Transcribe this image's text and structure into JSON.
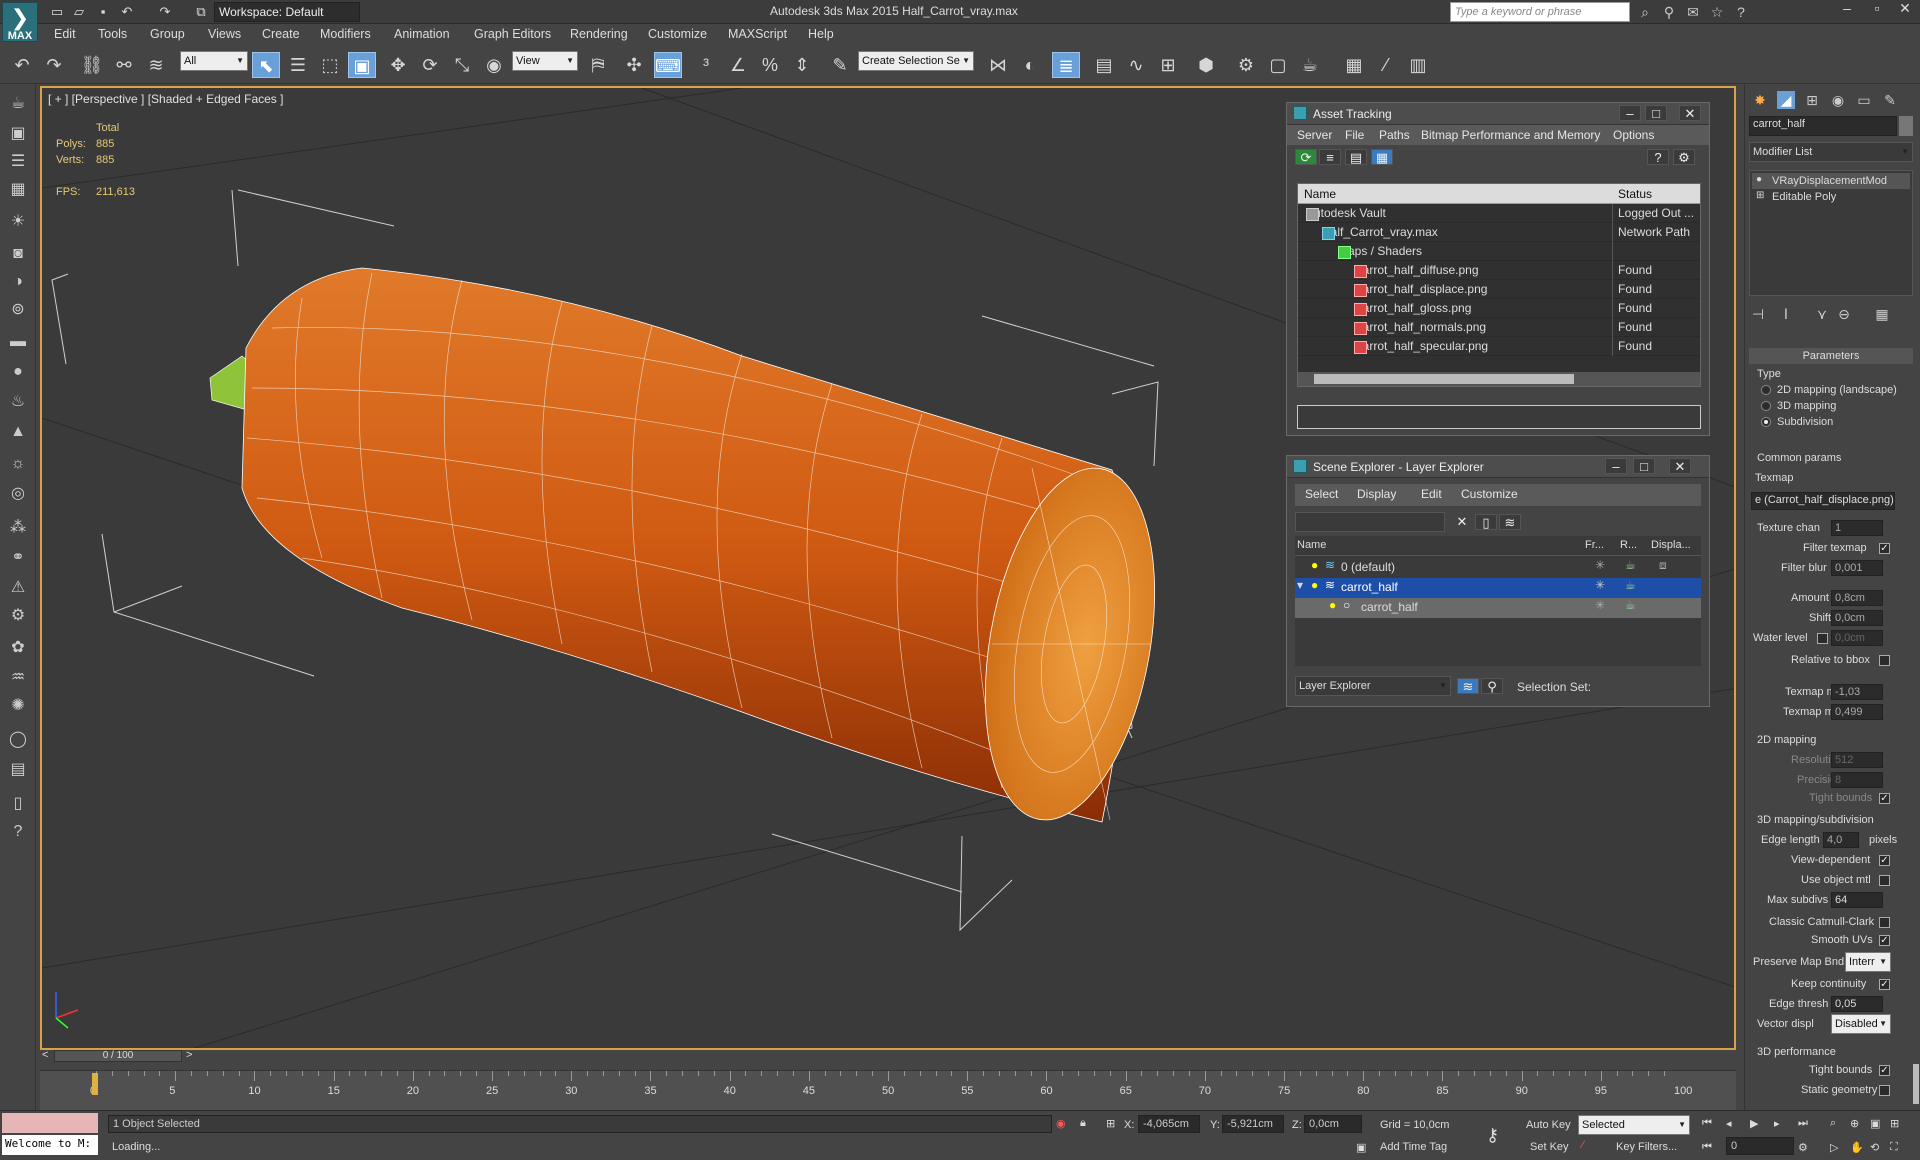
{
  "app": {
    "title": "Autodesk 3ds Max  2015    Half_Carrot_vray.max",
    "logo": "MAX",
    "workspace": "Workspace: Default",
    "search_placeholder": "Type a keyword or phrase"
  },
  "menus": [
    "Edit",
    "Tools",
    "Group",
    "Views",
    "Create",
    "Modifiers",
    "Animation",
    "Graph Editors",
    "Rendering",
    "Customize",
    "MAXScript",
    "Help"
  ],
  "toolbar": {
    "filter": "All",
    "refcoord": "View",
    "selset": "Create Selection Se"
  },
  "viewport": {
    "label": "[ + ] [Perspective ] [Shaded + Edged Faces ]",
    "total": "Total",
    "polys_label": "Polys:",
    "polys": "885",
    "verts_label": "Verts:",
    "verts": "885",
    "fps_label": "FPS:",
    "fps": "211,613"
  },
  "asset": {
    "title": "Asset Tracking",
    "menu": [
      "Server",
      "File",
      "Paths",
      "Bitmap Performance and Memory",
      "Options"
    ],
    "col_name": "Name",
    "col_status": "Status",
    "rows": [
      {
        "name": "Autodesk Vault",
        "status": "Logged Out ...",
        "indent": 0
      },
      {
        "name": "Half_Carrot_vray.max",
        "status": "Network Path",
        "indent": 1
      },
      {
        "name": "Maps / Shaders",
        "status": "",
        "indent": 2
      },
      {
        "name": "Carrot_half_diffuse.png",
        "status": "Found",
        "indent": 3
      },
      {
        "name": "Carrot_half_displace.png",
        "status": "Found",
        "indent": 3
      },
      {
        "name": "Carrot_half_gloss.png",
        "status": "Found",
        "indent": 3
      },
      {
        "name": "Carrot_half_normals.png",
        "status": "Found",
        "indent": 3
      },
      {
        "name": "Carrot_half_specular.png",
        "status": "Found",
        "indent": 3
      }
    ]
  },
  "scene": {
    "title": "Scene Explorer - Layer Explorer",
    "menu": [
      "Select",
      "Display",
      "Edit",
      "Customize"
    ],
    "col_name": "Name",
    "col_fr": "Fr...",
    "col_r": "R...",
    "col_disp": "Displa...",
    "rows": [
      "0 (default)",
      "carrot_half",
      "carrot_half"
    ],
    "footer_combo": "Layer Explorer",
    "selset": "Selection Set:"
  },
  "right": {
    "object_name": "carrot_half",
    "modifier_list": "Modifier List",
    "stack": [
      "VRayDisplacementMod",
      "Editable Poly"
    ],
    "params_title": "Parameters",
    "type_label": "Type",
    "type_opts": [
      "2D mapping (landscape)",
      "3D mapping",
      "Subdivision"
    ],
    "common": "Common params",
    "texmap_label": "Texmap",
    "texmap": "e (Carrot_half_displace.png)",
    "texture_chan_label": "Texture chan",
    "texture_chan": "1",
    "filter_texmap": "Filter texmap",
    "filter_blur_label": "Filter blur",
    "filter_blur": "0,001",
    "amount_label": "Amount",
    "amount": "0,8cm",
    "shift_label": "Shift",
    "shift": "0,0cm",
    "water_label": "Water level",
    "water": "0,0cm",
    "relative": "Relative to bbox",
    "texmin_label": "Texmap min",
    "texmin": "-1,03",
    "texmax_label": "Texmap max",
    "texmax": "0,499",
    "map2d": "2D mapping",
    "res_label": "Resolution",
    "res": "512",
    "prec_label": "Precision",
    "prec": "8",
    "tight": "Tight bounds",
    "map3d": "3D mapping/subdivision",
    "edge_label": "Edge length",
    "edge": "4,0",
    "pixels": "pixels",
    "viewdep": "View-dependent",
    "useobj": "Use object mtl",
    "maxsub_label": "Max subdivs",
    "maxsub": "64",
    "catmull": "Classic Catmull-Clark",
    "smooth": "Smooth UVs",
    "preserve_label": "Preserve Map Bnd",
    "preserve": "Interr",
    "keep": "Keep continuity",
    "ethresh_label": "Edge thresh",
    "ethresh": "0,05",
    "vecdisp_label": "Vector displ",
    "vecdisp": "Disabled",
    "perf": "3D performance",
    "tight2": "Tight bounds",
    "static": "Static geometry"
  },
  "timeline": {
    "frame": "0 / 100",
    "ticks": [
      "0",
      "5",
      "10",
      "15",
      "20",
      "25",
      "30",
      "35",
      "40",
      "45",
      "50",
      "55",
      "60",
      "65",
      "70",
      "75",
      "80",
      "85",
      "90",
      "95",
      "100"
    ]
  },
  "status": {
    "welcome": "Welcome to M:",
    "selected": "1 Object Selected",
    "loading": "Loading...",
    "x_label": "X:",
    "x": "-4,065cm",
    "y_label": "Y:",
    "y": "-5,921cm",
    "z_label": "Z:",
    "z": "0,0cm",
    "grid": "Grid = 10,0cm",
    "addtime": "Add Time Tag",
    "autokey": "Auto Key",
    "setkey": "Set Key",
    "keymode": "Selected",
    "keyfilters": "Key Filters...",
    "frame": "0"
  }
}
